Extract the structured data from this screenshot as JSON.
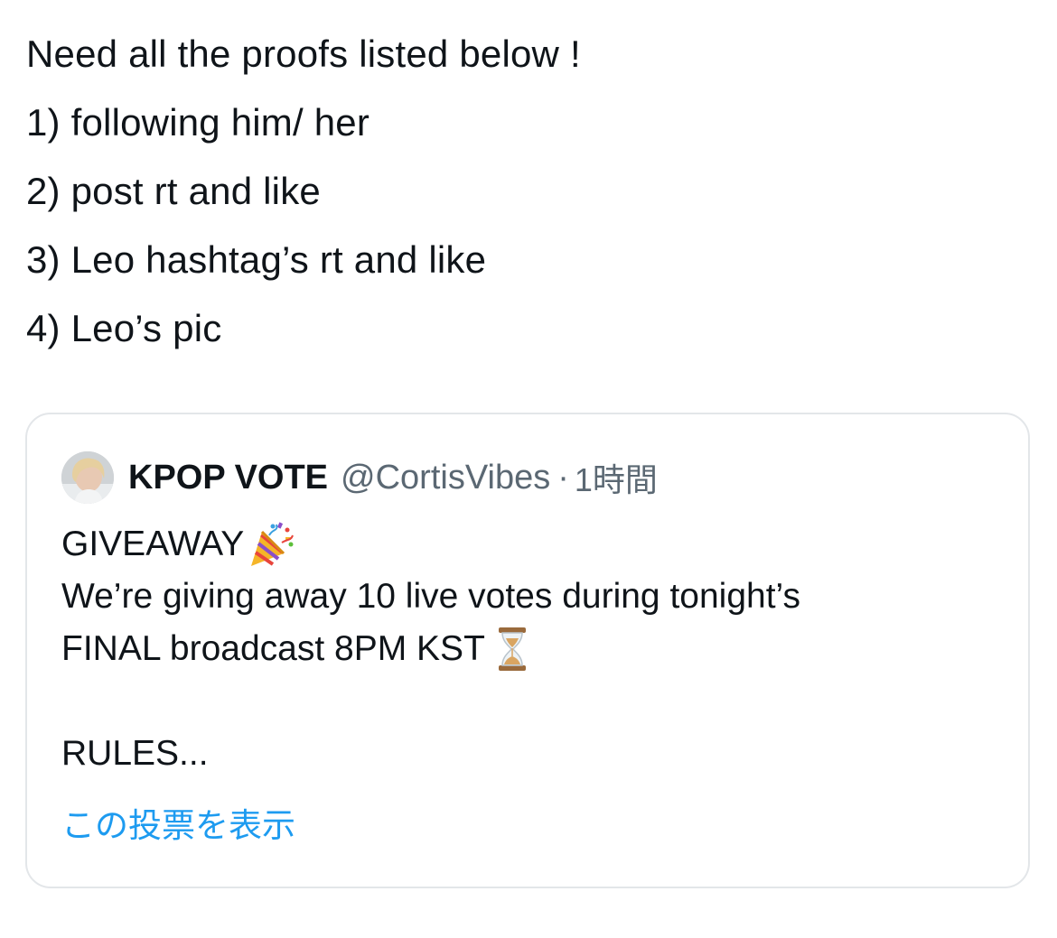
{
  "tweet": {
    "lines": [
      "Need all the proofs listed below !",
      "1) following him/ her",
      "2) post rt and like",
      "3) Leo hashtag’s rt and like",
      "4) Leo’s pic"
    ]
  },
  "quote": {
    "author_name": "KPOP VOTE",
    "handle": "@CortisVibes",
    "separator": "·",
    "time": "1時間",
    "line1": "GIVEAWAY",
    "line1_emoji": "party-popper-icon",
    "line2": "We’re giving away 10 live votes during tonight’s",
    "line3": "FINAL broadcast 8PM KST",
    "line3_emoji": "hourglass-icon",
    "line4": "RULES...",
    "show_link": "この投票を表示"
  },
  "colors": {
    "text": "#0f1419",
    "secondary": "#5b6873",
    "link": "#1d9bf0",
    "border": "#e3e6e9"
  }
}
